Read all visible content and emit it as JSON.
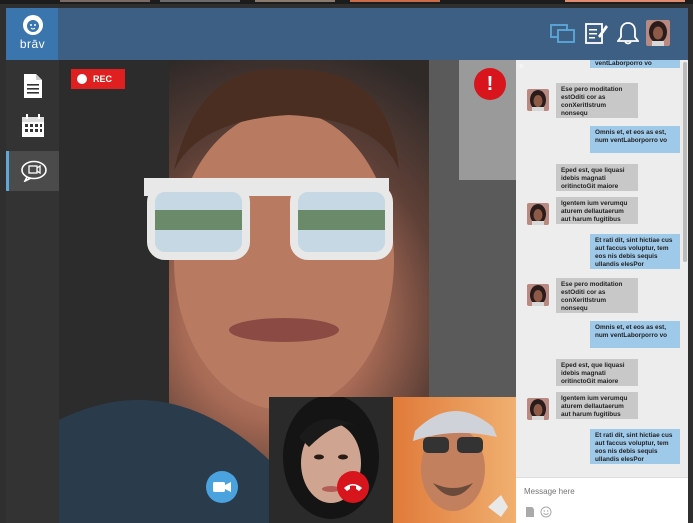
{
  "app": {
    "brand": "brāv"
  },
  "video": {
    "rec_label": "REC",
    "alert_symbol": "!"
  },
  "chat": {
    "collapse_symbol": "«",
    "placeholder": "Message here",
    "messages": [
      {
        "dir": "out",
        "text": "ventLaborporro vo"
      },
      {
        "dir": "in",
        "text": "Ese pero moditation estOditi cor as conXeritlstrum nonsequ"
      },
      {
        "dir": "out",
        "text": "Omnis et, et eos as est, num ventLaborporro vo"
      },
      {
        "dir": "in",
        "text": "Eped est, que liquasi idebis magnati oritinctoGit maiore"
      },
      {
        "dir": "in",
        "text": "Igentem ium verumqu aturem dellautaerum aut harum fugitibus"
      },
      {
        "dir": "out",
        "text": "Et rati dit, sint hictiae cus aut faccus voluptur, tem eos nis debis sequis ullandis elesPor"
      },
      {
        "dir": "in",
        "text": "Ese pero moditation estOditi cor as conXeritlstrum nonsequ"
      },
      {
        "dir": "out",
        "text": "Omnis et, et eos as est, num ventLaborporro vo"
      },
      {
        "dir": "in",
        "text": "Eped est, que liquasi idebis magnati oritinctoGit maiore"
      },
      {
        "dir": "in",
        "text": "Igentem ium verumqu aturem dellautaerum aut harum fugitibus"
      },
      {
        "dir": "out",
        "text": "Et rati dit, sint hictiae cus aut faccus voluptur, tem eos nis debis sequis ullandis elesPor"
      }
    ]
  },
  "colors": {
    "header": "#3d5f84",
    "accent": "#5ba9dc",
    "rec": "#e02020",
    "hangup": "#d8141c"
  }
}
